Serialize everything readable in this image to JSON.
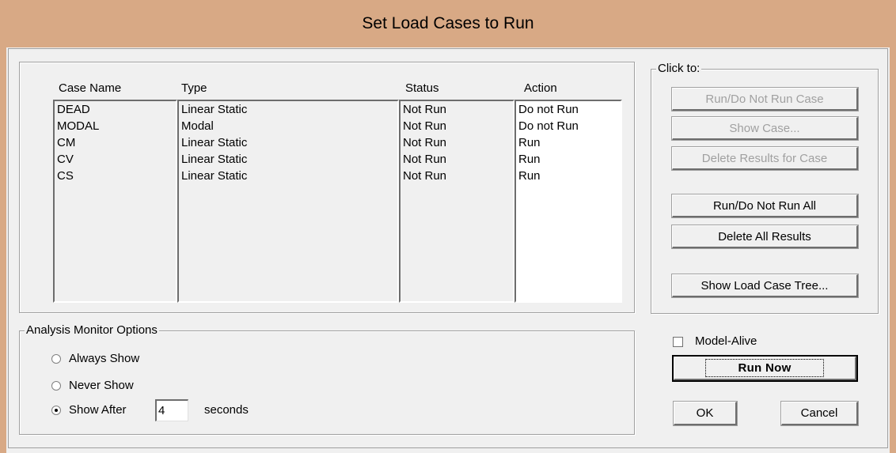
{
  "window": {
    "title": "Set Load Cases to Run"
  },
  "cases_table": {
    "headers": {
      "case_name": "Case Name",
      "type": "Type",
      "status": "Status",
      "action": "Action"
    },
    "rows": [
      {
        "case_name": "DEAD",
        "type": "Linear Static",
        "status": "Not Run",
        "action": "Do not Run"
      },
      {
        "case_name": "MODAL",
        "type": "Modal",
        "status": "Not Run",
        "action": "Do not Run"
      },
      {
        "case_name": "CM",
        "type": "Linear Static",
        "status": "Not Run",
        "action": "Run"
      },
      {
        "case_name": "CV",
        "type": "Linear Static",
        "status": "Not Run",
        "action": "Run"
      },
      {
        "case_name": "CS",
        "type": "Linear Static",
        "status": "Not Run",
        "action": "Run"
      }
    ]
  },
  "click_to": {
    "legend": "Click to:",
    "run_do_not_run_case": "Run/Do Not Run Case",
    "show_case": "Show Case...",
    "delete_results_for_case": "Delete Results for Case",
    "run_do_not_run_all": "Run/Do Not Run All",
    "delete_all_results": "Delete All Results",
    "show_load_case_tree": "Show Load Case Tree..."
  },
  "analysis_monitor": {
    "legend": "Analysis Monitor Options",
    "always_show": "Always Show",
    "never_show": "Never Show",
    "show_after": "Show After",
    "seconds_value": "4",
    "seconds_label": "seconds",
    "selected": "show_after"
  },
  "model_alive": {
    "label": "Model-Alive",
    "checked": false
  },
  "buttons": {
    "run_now": "Run Now",
    "ok": "OK",
    "cancel": "Cancel"
  },
  "colors": {
    "title_bar": "#d8a985",
    "dialog_bg": "#f0f0f0",
    "disabled_text": "#a0a0a0"
  }
}
